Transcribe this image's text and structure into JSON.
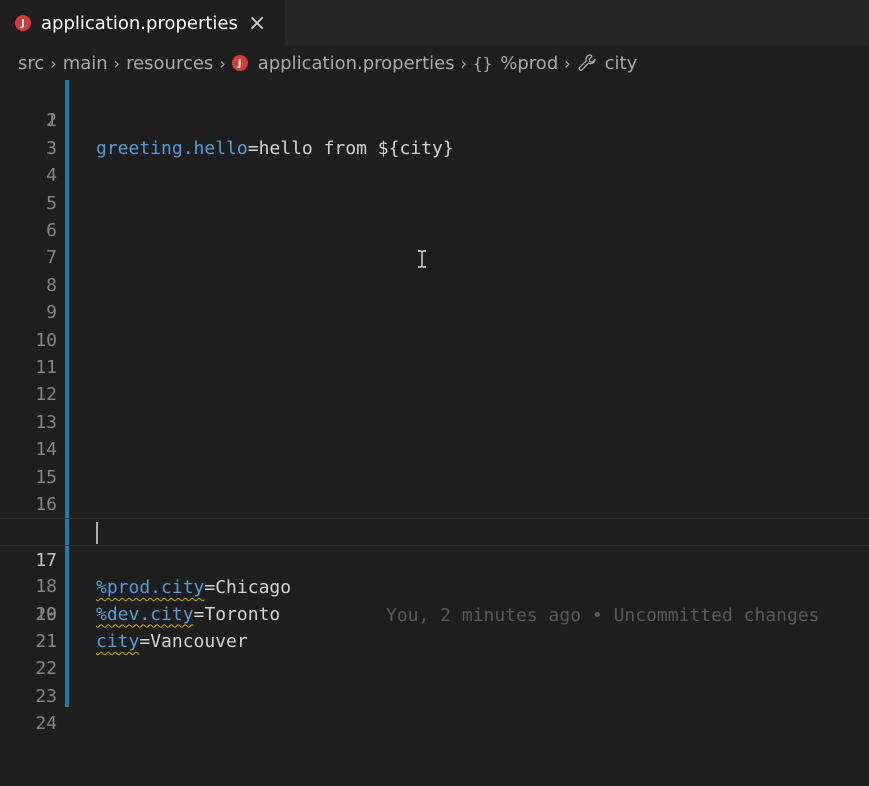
{
  "tab": {
    "icon": "java-icon",
    "icon_glyph": "J",
    "label": "application.properties",
    "close": "×"
  },
  "breadcrumb": {
    "items": [
      "src",
      "main",
      "resources"
    ],
    "file": "application.properties",
    "profile_icon": "{}",
    "profile": "%prod",
    "property": "city"
  },
  "editor": {
    "line_numbers": [
      "1",
      "2",
      "3",
      "4",
      "5",
      "6",
      "7",
      "8",
      "9",
      "10",
      "11",
      "12",
      "13",
      "14",
      "15",
      "16",
      "17",
      "18",
      "19",
      "20",
      "21",
      "22",
      "23",
      "24"
    ],
    "line1": {
      "key": "greeting.hello",
      "eq": "=",
      "value": "hello from ${city}"
    },
    "line17": {
      "key": "%prod.city",
      "eq": "=",
      "value": "Chicago"
    },
    "line18": {
      "key": "%dev.city",
      "eq": "=",
      "value": "Toronto"
    },
    "line19": {
      "key": "city",
      "eq": "=",
      "value": "Vancouver"
    },
    "blame": "You, 2 minutes ago • Uncommitted changes"
  },
  "colors": {
    "accent": "#1b81a8",
    "key": "#569cd6",
    "java_icon": "#d53b3b"
  }
}
